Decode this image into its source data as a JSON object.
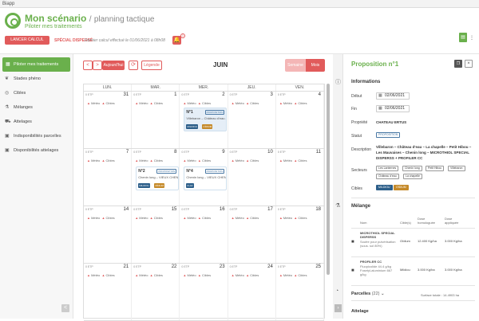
{
  "window": {
    "title": "Biapp"
  },
  "header": {
    "app_title": "Mon scénario",
    "separator": "/",
    "page": "planning tactique",
    "subtitle": "Piloter mes traitements",
    "action_button": "LANCER CALCUL",
    "mode_label": "SPÉCIAL DISPERSÉ",
    "calc_note": "Dernier calcul effectué le 01/06/2021 à 08h08",
    "notif_count": "1"
  },
  "sidebar": {
    "items": [
      {
        "label": "Piloter mes traitements",
        "icon": "calendar-icon",
        "active": true
      },
      {
        "label": "Stades phéno",
        "icon": "leaf-icon",
        "active": false
      },
      {
        "label": "Cibles",
        "icon": "target-icon",
        "active": false
      },
      {
        "label": "Mélanges",
        "icon": "flask-icon",
        "active": false
      },
      {
        "label": "Attelages",
        "icon": "tractor-icon",
        "active": false
      },
      {
        "label": "Indisponibilités parcelles",
        "icon": "calendar-x-icon",
        "active": false
      },
      {
        "label": "Disponibilités attelages",
        "icon": "calendar-check-icon",
        "active": false
      }
    ],
    "collapse_icon": "<"
  },
  "calendar": {
    "prev": "<",
    "next": ">",
    "today": "Aujourd'hui",
    "legend": "Légende",
    "month": "JUIN",
    "view_week": "Semaine",
    "view_month": "Mois",
    "days": [
      "LUN.",
      "MAR.",
      "MER.",
      "JEU.",
      "VEN."
    ],
    "etp_label": "0 ETP",
    "warn_a": "Météo",
    "warn_b": "Cibles",
    "weeks": [
      [
        "31",
        "1",
        "2",
        "3",
        "4"
      ],
      [
        "7",
        "8",
        "9",
        "10",
        "11"
      ],
      [
        "14",
        "15",
        "16",
        "17",
        "18"
      ],
      [
        "21",
        "22",
        "23",
        "24",
        "25"
      ]
    ],
    "events": [
      {
        "name": "N°1",
        "tag": "PROPOSITION",
        "desc": "Villebaron – Château d'eau – La chapelle",
        "b1": "MILDIOU",
        "b2": "OÏDIUM"
      },
      {
        "name": "N°2",
        "tag": "PROPOSITION",
        "desc": "Chenin long – VIEUX CHENIN",
        "b1": "MILDIOU",
        "b2": "OÏDIUM"
      },
      {
        "name": "N°4",
        "tag": "PROPOSITION",
        "desc": "Chenin long – VIEUX CHENIN",
        "b1": "FLAV"
      }
    ]
  },
  "panel": {
    "title": "Proposition n°1",
    "section_info": "Informations",
    "start_label": "Début",
    "start": "02/06/2021",
    "end_label": "Fin",
    "end": "02/06/2021",
    "property_label": "Propriété",
    "property": "CHATEAU ERTUS",
    "status_label": "Statut",
    "status": "PROPOSITION",
    "description_label": "Description",
    "description": "Villebaron – Château d'eau – La chapelle – Petit Hibou – Les Mauvaises – Chenin long – MICROTHIOL SPECIAL DISPERSS + PROFILER CC",
    "sectors_label": "Secteurs",
    "sectors": [
      "Les Lanternes",
      "Chenin long",
      "Petit Hibou",
      "Villebaron",
      "Château d'eau",
      "La chapelle"
    ],
    "targets_label": "Cibles",
    "targets": [
      "MILDIOU",
      "OÏDIUM"
    ],
    "section_mix": "Mélange",
    "mix_headers": [
      "Nom",
      "Cible(s)",
      "Dose homologuée",
      "Dose appliquée"
    ],
    "mix_rows": [
      {
        "name": "MICROTHIOL SPECIAL DISPERSS",
        "sub": "Soufre pour pulvérisation (sous. sol 80%)",
        "target": "Oïdium",
        "dose_hom": "12.400 Kg/ha",
        "dose_app": "3.000 Kg/ha"
      },
      {
        "name": "PROFILER CC",
        "sub": "Fluopicolide 44.4 g/kg Fosetyl-aluminium 667 g/kg",
        "target": "Mildiou",
        "dose_hom": "3.000 Kg/ha",
        "dose_app": "3.000 Kg/ha"
      }
    ],
    "parcels_label": "Parcelles",
    "parcels_count": "(22)",
    "surface_label": "Surface totale : 14.4903 ha",
    "section_attelage": "Attelage"
  }
}
